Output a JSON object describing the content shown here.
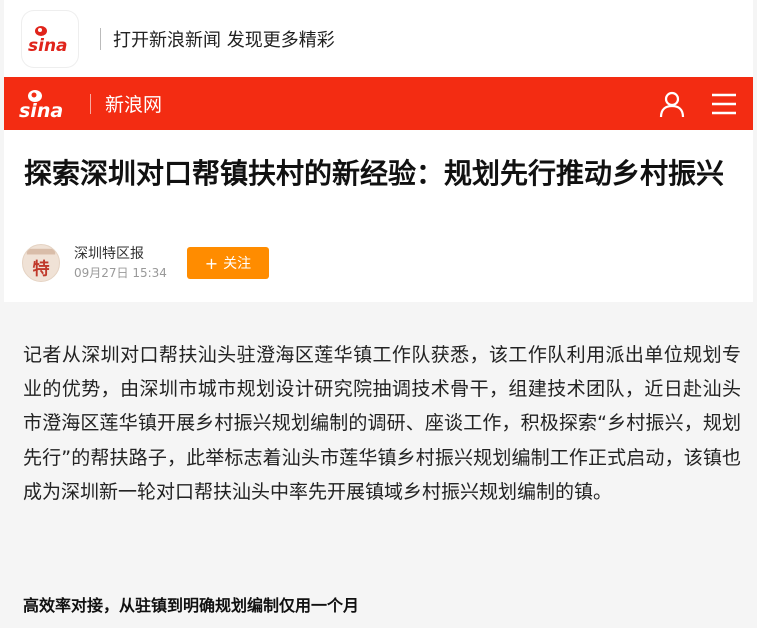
{
  "app_banner": {
    "logo_text": "sina",
    "text": "打开新浪新闻 发现更多精彩"
  },
  "nav": {
    "logo_text": "sina",
    "title": "新浪网",
    "user_icon": "user-icon",
    "menu_icon": "hamburger-menu-icon"
  },
  "article": {
    "title": "探索深圳对口帮镇扶村的新经验：规划先行推动乡村振兴",
    "author": {
      "name": "深圳特区报",
      "time": "09月27日  15:34",
      "avatar_char": "特",
      "follow_label": "关注"
    },
    "body": "记者从深圳对口帮扶汕头驻澄海区莲华镇工作队获悉，该工作队利用派出单位规划专业的优势，由深圳市城市规划设计研究院抽调技术骨干，组建技术团队，近日赴汕头市澄海区莲华镇开展乡村振兴规划编制的调研、座谈工作，积极探索“乡村振兴，规划先行”的帮扶路子，此举标志着汕头市莲华镇乡村振兴规划编制工作正式启动，该镇也成为深圳新一轮对口帮扶汕头中率先开展镇域乡村振兴规划编制的镇。",
    "subhead": "高效率对接，从驻镇到明确规划编制仅用一个月"
  },
  "colors": {
    "brand_red": "#f32c12",
    "follow_orange": "#ff8c00"
  }
}
